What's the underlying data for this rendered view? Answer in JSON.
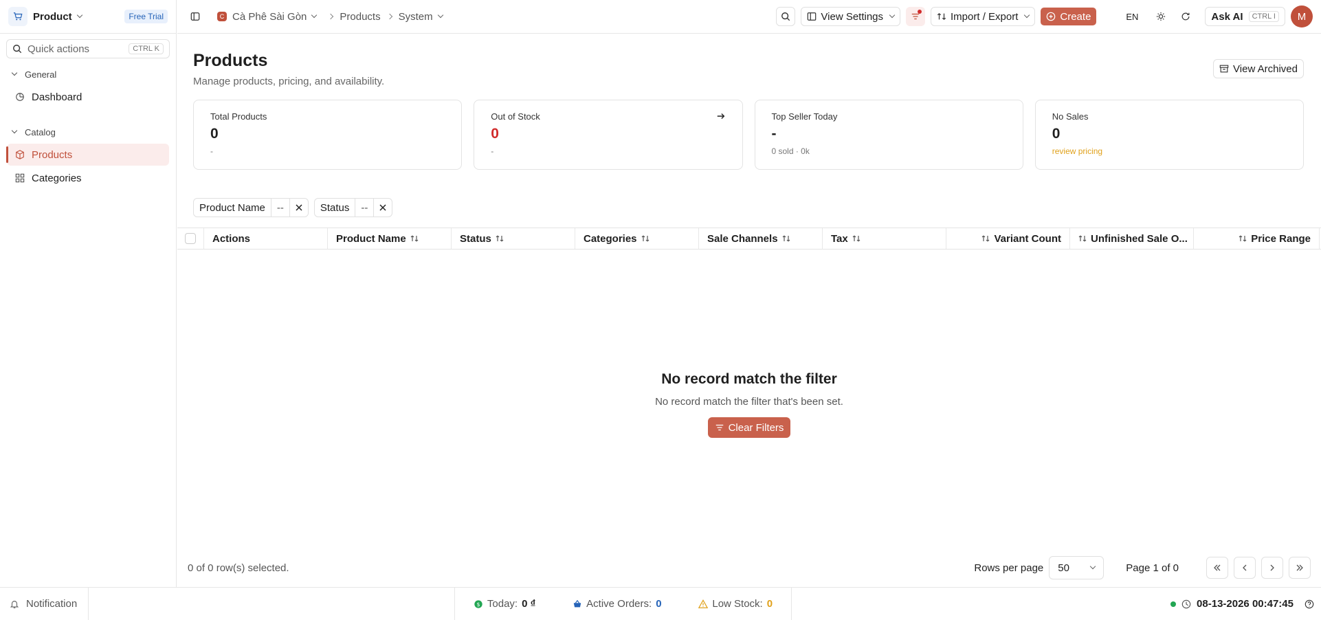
{
  "sidebar": {
    "app_name": "Product",
    "trial_badge": "Free Trial",
    "quick_actions": {
      "label": "Quick actions",
      "shortcut": "CTRL K"
    },
    "groups": [
      {
        "label": "General",
        "items": [
          {
            "label": "Dashboard",
            "icon": "dashboard-icon"
          }
        ]
      },
      {
        "label": "Catalog",
        "items": [
          {
            "label": "Products",
            "icon": "box-icon",
            "active": true
          },
          {
            "label": "Categories",
            "icon": "grid-icon"
          }
        ]
      }
    ]
  },
  "topbar": {
    "breadcrumb": {
      "store": "Cà Phê Sài Gòn",
      "store_initial": "C",
      "section": "Products",
      "scope": "System"
    },
    "view_settings": "View Settings",
    "import_export": "Import / Export",
    "create": "Create",
    "language": "EN",
    "ask_ai": {
      "label": "Ask AI",
      "shortcut": "CTRL I"
    },
    "avatar_initial": "M"
  },
  "page": {
    "title": "Products",
    "subtitle": "Manage products, pricing, and availability.",
    "view_archived": "View Archived"
  },
  "cards": [
    {
      "label": "Total Products",
      "value": "0",
      "sub": "-"
    },
    {
      "label": "Out of Stock",
      "value": "0",
      "sub": "-"
    },
    {
      "label": "Top Seller Today",
      "value": "-",
      "sub": "0 sold · 0k"
    },
    {
      "label": "No Sales",
      "value": "0",
      "sub": "review pricing"
    }
  ],
  "filters": [
    {
      "label": "Product Name",
      "value": "--"
    },
    {
      "label": "Status",
      "value": "--"
    }
  ],
  "table": {
    "columns": [
      "Actions",
      "Product Name",
      "Status",
      "Categories",
      "Sale Channels",
      "Tax",
      "Variant Count",
      "Unfinished Sale O...",
      "Price Range"
    ]
  },
  "empty_state": {
    "title": "No record match the filter",
    "message": "No record match the filter that's been set.",
    "button": "Clear Filters"
  },
  "pagination": {
    "selected": "0 of 0 row(s) selected.",
    "rows_per_page_label": "Rows per page",
    "rows_per_page": "50",
    "page": "Page 1 of 0"
  },
  "footer": {
    "notification": "Notification",
    "today_label": "Today:",
    "today_value": "0 ₫",
    "orders_label": "Active Orders:",
    "orders_value": "0",
    "stock_label": "Low Stock:",
    "stock_value": "0",
    "datetime": "08-13-2026 00:47:45"
  },
  "colors": {
    "accent": "#c9614c",
    "danger": "#d12b2b",
    "warning": "#e0a11b",
    "info": "#2563b8"
  }
}
